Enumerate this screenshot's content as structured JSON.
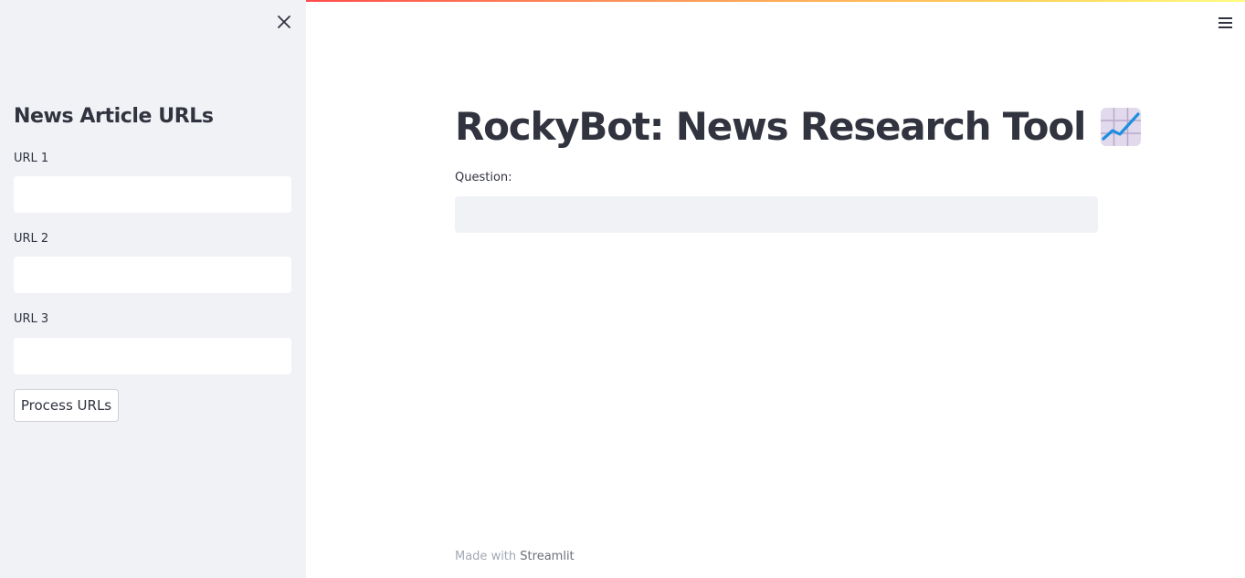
{
  "sidebar": {
    "close_icon": "close-icon",
    "heading": "News Article URLs",
    "urls": [
      {
        "label": "URL 1",
        "value": ""
      },
      {
        "label": "URL 2",
        "value": ""
      },
      {
        "label": "URL 3",
        "value": ""
      }
    ],
    "process_button_label": "Process URLs"
  },
  "header": {
    "menu_icon": "hamburger-menu-icon",
    "gradient_colors": [
      "#ff4b4b",
      "#ff8c57",
      "#fdd85b",
      "#fffd80"
    ]
  },
  "main": {
    "title": "RockyBot: News Research Tool",
    "title_emoji": "chart-increasing-icon",
    "question_label": "Question:",
    "question_value": ""
  },
  "footer": {
    "prefix": "Made with",
    "link": "Streamlit"
  },
  "colors": {
    "sidebar_bg": "#f0f2f6",
    "text": "#31333f",
    "input_bg_main": "#f0f2f6"
  }
}
